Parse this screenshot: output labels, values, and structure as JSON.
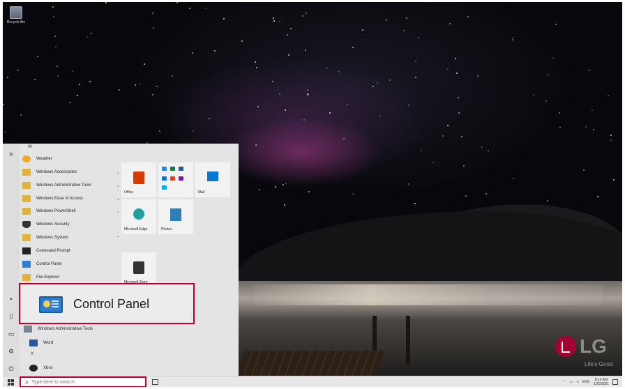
{
  "desktop": {
    "recycle_bin_label": "Recycle Bin",
    "brand_logo": "LG",
    "brand_slogan": "Life's Good"
  },
  "start_menu": {
    "letter_w": "W",
    "letter_x": "X",
    "apps": [
      {
        "label": "Weather",
        "icon": "weather-icon",
        "expandable": false
      },
      {
        "label": "Windows Accessories",
        "icon": "folder-icon",
        "expandable": true
      },
      {
        "label": "Windows Administrative Tools",
        "icon": "folder-icon",
        "expandable": true
      },
      {
        "label": "Windows Ease of Access",
        "icon": "folder-icon",
        "expandable": true
      },
      {
        "label": "Windows PowerShell",
        "icon": "folder-icon",
        "expandable": true
      },
      {
        "label": "Windows Security",
        "icon": "shield-icon",
        "expandable": false
      },
      {
        "label": "Windows System",
        "icon": "folder-icon",
        "expandable": true
      },
      {
        "label": "Command Prompt",
        "icon": "cmd-icon",
        "expandable": false
      },
      {
        "label": "Control Panel",
        "icon": "control-panel-icon",
        "expandable": false
      },
      {
        "label": "File Explorer",
        "icon": "file-explorer-icon",
        "expandable": false
      },
      {
        "label": "Windows Administrative Tools",
        "icon": "admin-tools-icon",
        "expandable": false
      },
      {
        "label": "Word",
        "icon": "word-icon",
        "expandable": false
      },
      {
        "label": "Xbox",
        "icon": "xbox-icon",
        "expandable": false
      }
    ],
    "tiles": [
      {
        "label": "Office",
        "icon": "office-icon"
      },
      {
        "label": "",
        "icon": "office-apps-group-icon"
      },
      {
        "label": "Mail",
        "icon": "mail-icon"
      },
      {
        "label": "Microsoft Edge",
        "icon": "edge-icon"
      },
      {
        "label": "Photos",
        "icon": "photos-icon"
      },
      {
        "label": "Microsoft Store",
        "icon": "store-icon"
      }
    ],
    "highlight": {
      "label": "Control Panel",
      "border_color": "#c3002d"
    }
  },
  "taskbar": {
    "search_placeholder": "Type here to search",
    "language": "ENG",
    "time": "8:15 AM",
    "date": "1/20/2021"
  },
  "colors": {
    "accent": "#c3002d",
    "lg_red": "#a50034",
    "folder": "#e2b33a"
  }
}
